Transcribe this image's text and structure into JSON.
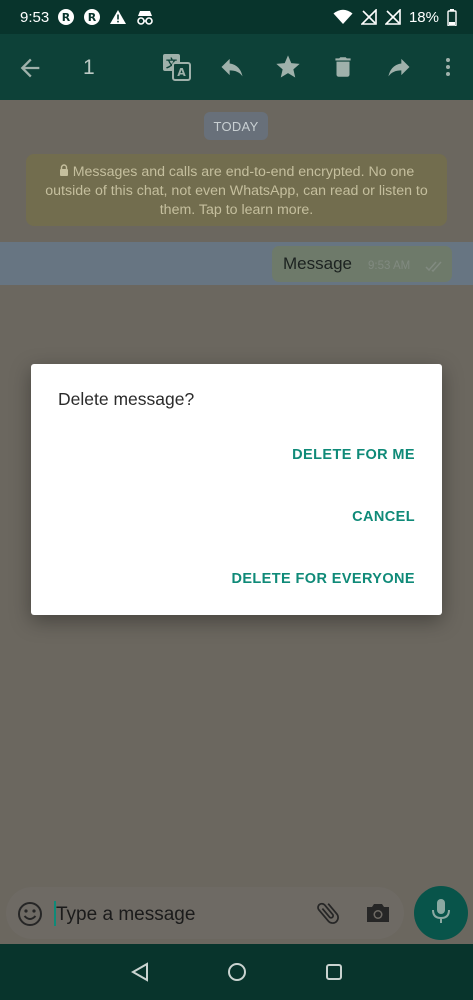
{
  "status_bar": {
    "time": "9:53",
    "battery": "18%"
  },
  "action_bar": {
    "selected_count": "1",
    "actions": [
      "back-icon",
      "translate-icon",
      "reply-icon",
      "star-icon",
      "delete-icon",
      "forward-icon",
      "more-vert-icon"
    ]
  },
  "chat": {
    "date_chip": "TODAY",
    "encryption_notice": "Messages and calls are end-to-end encrypted. No one outside of this chat, not even WhatsApp, can read or listen to them. Tap to learn more.",
    "message": {
      "text": "Message",
      "time": "9:53 AM",
      "status": "delivered"
    }
  },
  "dialog": {
    "title": "Delete message?",
    "buttons": {
      "delete_for_me": "DELETE FOR ME",
      "cancel": "CANCEL",
      "delete_for_everyone": "DELETE FOR EVERYONE"
    }
  },
  "composer": {
    "placeholder": "Type a message"
  },
  "colors": {
    "accent": "#0f8a78",
    "toolbar": "#0d4138",
    "statusbar": "#08342c",
    "scrim_background": "#6b675f"
  }
}
